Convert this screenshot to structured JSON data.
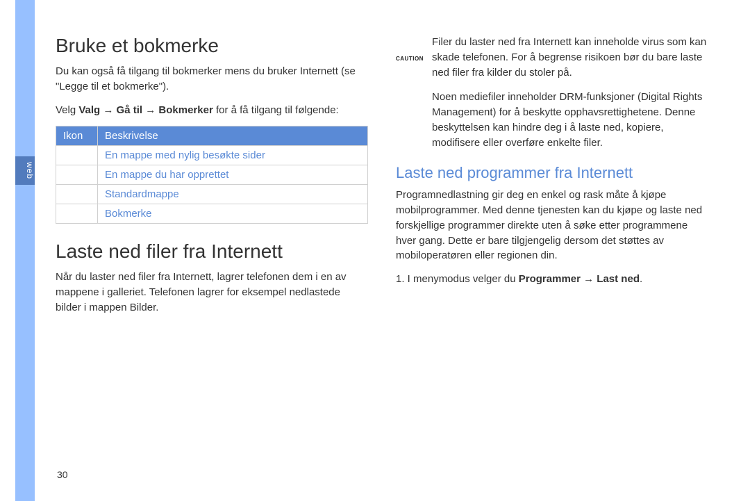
{
  "sidebar": {
    "tab": "web"
  },
  "page_number": "30",
  "left": {
    "h1a": "Bruke et bokmerke",
    "p1": "Du kan også få tilgang til bokmerker mens du bruker Internett (se \"Legge til et bokmerke\").",
    "instr_pre": "Velg ",
    "instr_bold": "Valg → Gå til → Bokmerker",
    "instr_post": " for å få tilgang til følgende:",
    "table": {
      "head": [
        "Ikon",
        "Beskrivelse"
      ],
      "rows": [
        [
          "",
          "En mappe med nylig besøkte sider"
        ],
        [
          "",
          "En mappe du har opprettet"
        ],
        [
          "",
          "Standardmappe"
        ],
        [
          "",
          "Bokmerke"
        ]
      ]
    },
    "h1b": "Laste ned filer fra Internett",
    "p2": "Når du laster ned filer fra Internett, lagrer telefonen dem i en av mappene i galleriet. Telefonen lagrer for eksempel nedlastede bilder i mappen Bilder."
  },
  "right": {
    "caution_label": "CAUTION",
    "caution_text": "Filer du laster ned fra Internett kan inneholde virus som kan skade telefonen. For å begrense risikoen bør du bare laste ned filer fra kilder du stoler på.",
    "drm_text": "Noen mediefiler inneholder DRM-funksjoner (Digital Rights Management) for å beskytte opphavsrettighetene. Denne beskyttelsen kan hindre deg i å laste ned, kopiere, modifisere eller overføre enkelte filer.",
    "h2": "Laste ned programmer fra Internett",
    "p3": "Programnedlastning gir deg en enkel og rask måte å kjøpe mobilprogrammer. Med denne tjenesten kan du kjøpe og laste ned forskjellige programmer direkte uten å søke etter programmene hver gang. Dette er bare tilgjengelig dersom det støttes av mobiloperatøren eller regionen din.",
    "step1_pre": "1.  I menymodus velger du ",
    "step1_bold": "Programmer → Last ned",
    "step1_post": "."
  }
}
